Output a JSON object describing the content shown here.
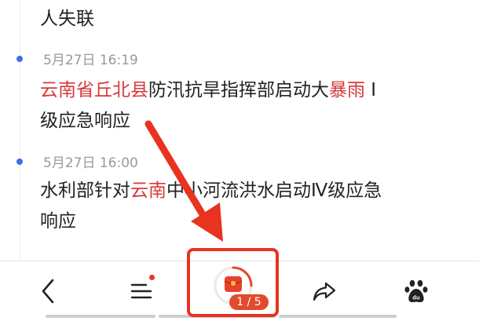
{
  "feed": {
    "prev_tail": "人失联",
    "items": [
      {
        "time": "5月27日 16:19",
        "line1": [
          {
            "text": "云南省丘北县",
            "hl": true
          },
          {
            "text": "防汛抗旱指挥部启动大",
            "hl": false
          },
          {
            "text": "暴雨",
            "hl": true
          },
          {
            "text": " Ⅰ",
            "hl": false
          }
        ],
        "line2": "级应急响应"
      },
      {
        "time": "5月27日 16:00",
        "line1": [
          {
            "text": "水利部针对",
            "hl": false
          },
          {
            "text": "云南",
            "hl": true
          },
          {
            "text": "中小河流洪水启动Ⅳ级应急",
            "hl": false
          }
        ],
        "line2": "响应"
      }
    ]
  },
  "bottom_bar": {
    "back_icon": "chevron-left-icon",
    "menu_icon": "menu-icon",
    "menu_has_notification": true,
    "red_envelope_icon": "red-envelope-icon",
    "red_envelope_progress": 0.25,
    "page_indicator": "1 / 5",
    "share_icon": "share-icon",
    "baidu_icon": "baidu-paw-icon"
  },
  "colors": {
    "highlight": "#d63a3a",
    "timeline_dot": "#3f6fe6",
    "annotation": "#e8331f",
    "pill": "#e24a2e"
  }
}
